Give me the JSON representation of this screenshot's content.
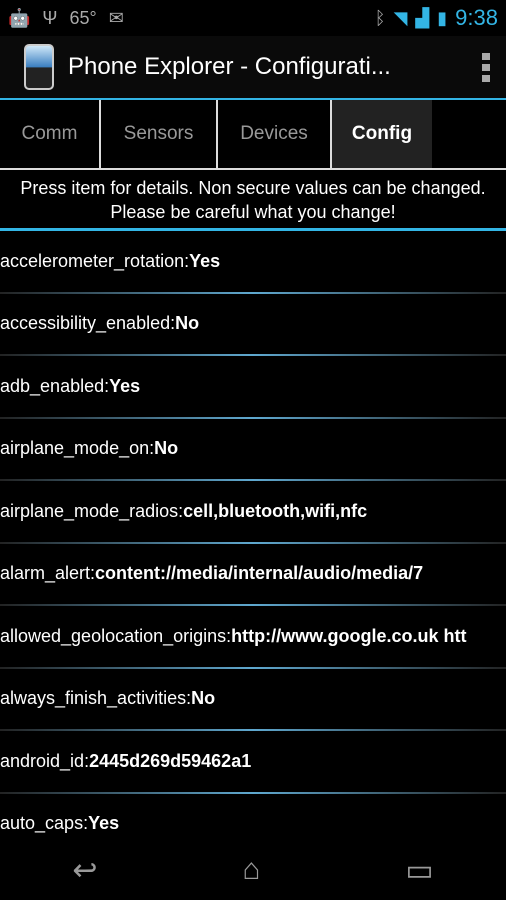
{
  "status": {
    "temperature": "65°",
    "time": "9:38"
  },
  "app": {
    "title": "Phone Explorer - Configurati..."
  },
  "tabs": [
    {
      "label": "Comm"
    },
    {
      "label": "Sensors"
    },
    {
      "label": "Devices"
    },
    {
      "label": "Config",
      "active": true
    }
  ],
  "hint": "Press item for details. Non secure values can be changed. Please be careful what you change!",
  "items": [
    {
      "key": "accelerometer_rotation:",
      "value": "Yes"
    },
    {
      "key": "accessibility_enabled:",
      "value": "No"
    },
    {
      "key": "adb_enabled:",
      "value": "Yes"
    },
    {
      "key": "airplane_mode_on:",
      "value": "No"
    },
    {
      "key": "airplane_mode_radios:",
      "value": "cell,bluetooth,wifi,nfc"
    },
    {
      "key": "alarm_alert:",
      "value": "content://media/internal/audio/media/7"
    },
    {
      "key": "allowed_geolocation_origins:",
      "value": "http://www.google.co.uk htt"
    },
    {
      "key": "always_finish_activities:",
      "value": "No"
    },
    {
      "key": "android_id:",
      "value": "2445d269d59462a1"
    },
    {
      "key": "auto_caps:",
      "value": "Yes"
    }
  ],
  "colors": {
    "accent": "#33b5e5"
  }
}
